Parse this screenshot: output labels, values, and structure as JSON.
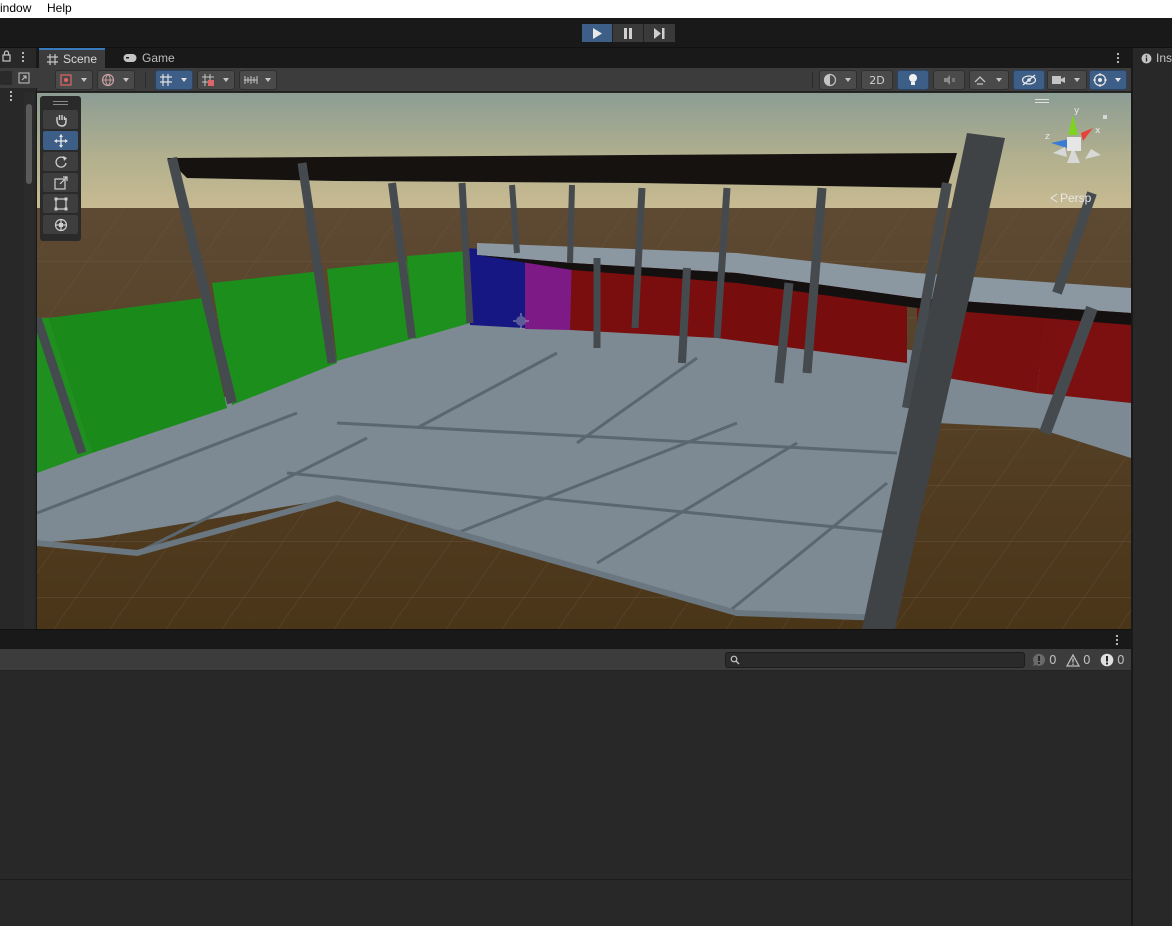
{
  "menu": {
    "window": "indow",
    "help": "Help"
  },
  "tabs": {
    "scene": "Scene",
    "game": "Game"
  },
  "scene_toolbar": {
    "mode_2d": "2D"
  },
  "gizmo": {
    "persp": "Persp",
    "x": "x",
    "y": "y",
    "z": "z"
  },
  "inspector": {
    "title": "Ins"
  },
  "console": {
    "info_count": "0",
    "warn_count": "0",
    "error_count": "0",
    "search_placeholder": ""
  },
  "colors": {
    "accent": "#3d5e86",
    "panel": "#282828",
    "toolbar": "#3c3c3c",
    "ground": "#4e3a1f",
    "green_block": "#1a8c1a",
    "red_block": "#7a0d0d",
    "blue_block": "#161680",
    "purple_block": "#7d1a86"
  }
}
